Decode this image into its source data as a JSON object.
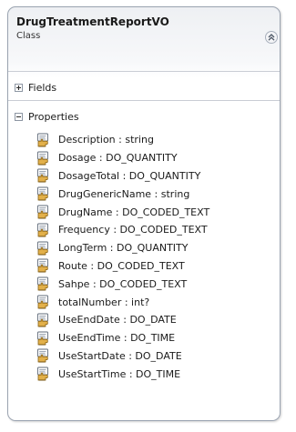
{
  "class": {
    "name": "DrugTreatmentReportVO",
    "stereotype": "Class"
  },
  "sections": {
    "fields_label": "Fields",
    "properties_label": "Properties"
  },
  "properties": [
    "Description : string",
    "Dosage : DO_QUANTITY",
    "DosageTotal : DO_QUANTITY",
    "DrugGenericName : string",
    "DrugName : DO_CODED_TEXT",
    "Frequency : DO_CODED_TEXT",
    "LongTerm : DO_QUANTITY",
    "Route : DO_CODED_TEXT",
    "Sahpe : DO_CODED_TEXT",
    "totalNumber : int?",
    "UseEndDate : DO_DATE",
    "UseEndTime : DO_TIME",
    "UseStartDate : DO_DATE",
    "UseStartTime : DO_TIME"
  ],
  "icons": {
    "collapse": "double-chevron-up-icon",
    "expand_fields": "plus-expander-icon",
    "collapse_properties": "minus-expander-icon",
    "property": "property-hand-icon"
  },
  "colors": {
    "border": "#9aa3b0",
    "header_bg": "#eef0f3",
    "icon_hand": "#e2b04a",
    "icon_card": "#ffffff"
  }
}
